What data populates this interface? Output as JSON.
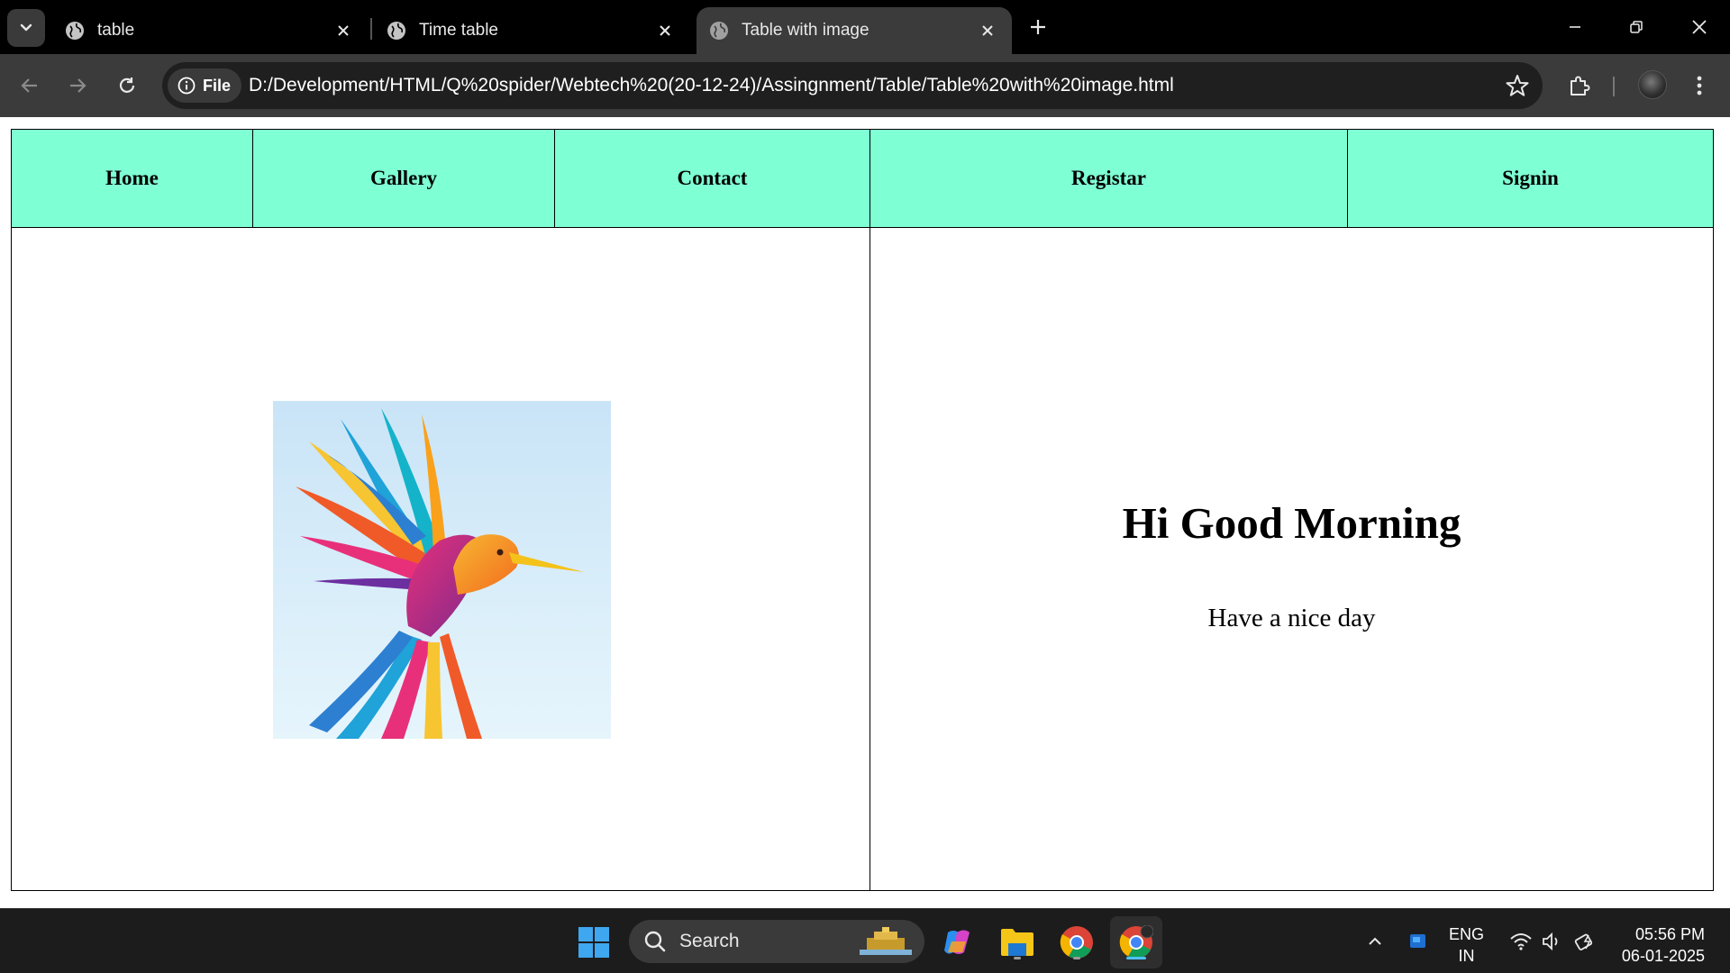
{
  "browser": {
    "tabs": [
      {
        "title": "table",
        "active": false
      },
      {
        "title": "Time table",
        "active": false
      },
      {
        "title": "Table with image",
        "active": true
      }
    ],
    "site_chip_label": "File",
    "url": "D:/Development/HTML/Q%20spider/Webtech%20(20-12-24)/Assingnment/Table/Table%20with%20image.html"
  },
  "page": {
    "menu": [
      "Home",
      "Gallery",
      "Contact",
      "Registar",
      "Signin"
    ],
    "greeting": "Hi Good Morning",
    "subtext": "Have a nice day",
    "menu_background": "#7fffd4",
    "image_subject": "colorful-hummingbird-illustration"
  },
  "taskbar": {
    "search_label": "Search",
    "language_top": "ENG",
    "language_bottom": "IN",
    "time": "05:56 PM",
    "date": "06-01-2025"
  },
  "colors": {
    "tabstrip": "#000000",
    "toolbar": "#3b3b3b",
    "taskbar": "#1c1c1c",
    "accent": "#4cc2ff"
  }
}
